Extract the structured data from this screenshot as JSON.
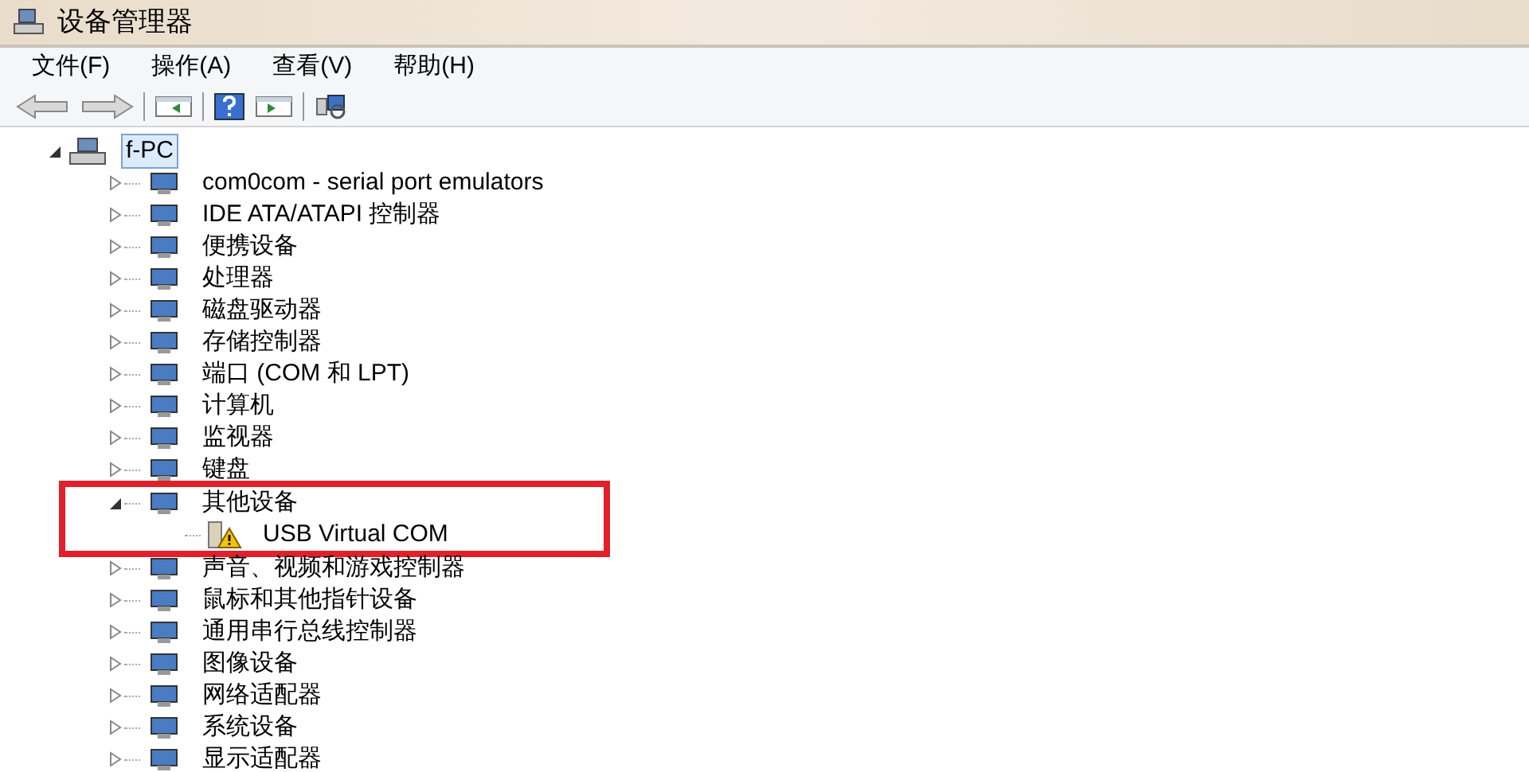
{
  "window": {
    "title": "设备管理器"
  },
  "menu": [
    "文件(F)",
    "操作(A)",
    "查看(V)",
    "帮助(H)"
  ],
  "tree": {
    "label": "f-PC",
    "expanded": true,
    "selected": true,
    "children": [
      {
        "label": "com0com - serial port emulators",
        "expanded": false
      },
      {
        "label": "IDE ATA/ATAPI 控制器",
        "expanded": false
      },
      {
        "label": "便携设备",
        "expanded": false
      },
      {
        "label": "处理器",
        "expanded": false
      },
      {
        "label": "磁盘驱动器",
        "expanded": false
      },
      {
        "label": "存储控制器",
        "expanded": false
      },
      {
        "label": "端口 (COM 和 LPT)",
        "expanded": false
      },
      {
        "label": "计算机",
        "expanded": false
      },
      {
        "label": "监视器",
        "expanded": false
      },
      {
        "label": "键盘",
        "expanded": false
      },
      {
        "label": "其他设备",
        "expanded": true,
        "highlighted": true,
        "children": [
          {
            "label": "USB Virtual COM",
            "problem": true
          }
        ]
      },
      {
        "label": "声音、视频和游戏控制器",
        "expanded": false
      },
      {
        "label": "鼠标和其他指针设备",
        "expanded": false
      },
      {
        "label": "通用串行总线控制器",
        "expanded": false
      },
      {
        "label": "图像设备",
        "expanded": false
      },
      {
        "label": "网络适配器",
        "expanded": false
      },
      {
        "label": "系统设备",
        "expanded": false
      },
      {
        "label": "显示适配器",
        "expanded": false
      }
    ]
  }
}
